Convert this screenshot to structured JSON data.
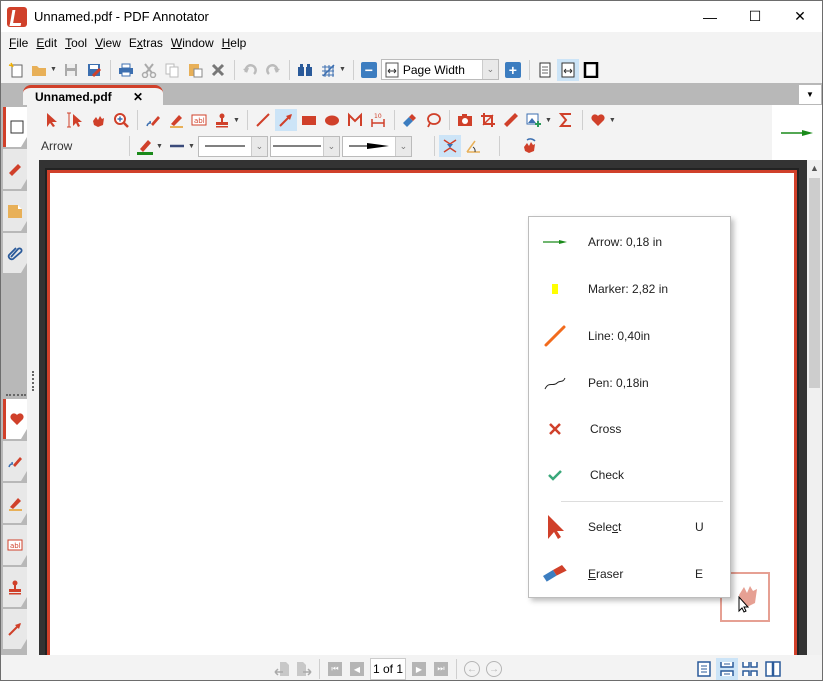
{
  "window": {
    "title": "Unnamed.pdf - PDF Annotator",
    "controls": {
      "minimize": "—",
      "maximize": "☐",
      "close": "✕"
    }
  },
  "menubar": [
    {
      "label": "File",
      "accel": "F",
      "rest": "ile"
    },
    {
      "label": "Edit",
      "accel": "E",
      "rest": "dit"
    },
    {
      "label": "Tool",
      "accel": "T",
      "rest": "ool"
    },
    {
      "label": "View",
      "accel": "V",
      "rest": "iew"
    },
    {
      "label": "Extras",
      "pre": "E",
      "accel": "x",
      "rest": "tras"
    },
    {
      "label": "Window",
      "accel": "W",
      "rest": "indow"
    },
    {
      "label": "Help",
      "accel": "H",
      "rest": "elp"
    }
  ],
  "toolbar": {
    "zoom_mode": "Page Width",
    "zoom_out": "−",
    "zoom_in": "+"
  },
  "document_tab": {
    "label": "Unnamed.pdf",
    "close": "✕"
  },
  "tool_panel": {
    "current_tool_label": "Arrow",
    "line_style": "solid",
    "line_style_2": "solid",
    "line_end": "arrow"
  },
  "favorites_popup": {
    "items": [
      {
        "label": "Arrow: 0,18 in",
        "icon": "green-arrow-icon"
      },
      {
        "label": "Marker: 2,82 in",
        "icon": "yellow-marker-icon"
      },
      {
        "label": "Line: 0,40in",
        "icon": "orange-line-icon"
      },
      {
        "label": "Pen: 0,18in",
        "icon": "pen-squiggle-icon"
      },
      {
        "label": "Cross",
        "icon": "cross-icon"
      },
      {
        "label": "Check",
        "icon": "check-icon"
      }
    ],
    "commands": [
      {
        "pre": "Sele",
        "accel": "c",
        "rest": "t",
        "label": "Select",
        "shortcut": "U"
      },
      {
        "pre": "",
        "accel": "E",
        "rest": "raser",
        "label": "Eraser",
        "shortcut": "E"
      }
    ]
  },
  "navigation": {
    "page_indicator": "1 of 1"
  },
  "colors": {
    "accent": "#d0402a",
    "selected": "#cce4f7",
    "arrow_green": "#1a8a1a",
    "marker_yellow": "#ffff00",
    "line_orange": "#f26b1d",
    "check_green": "#3aa87a"
  }
}
